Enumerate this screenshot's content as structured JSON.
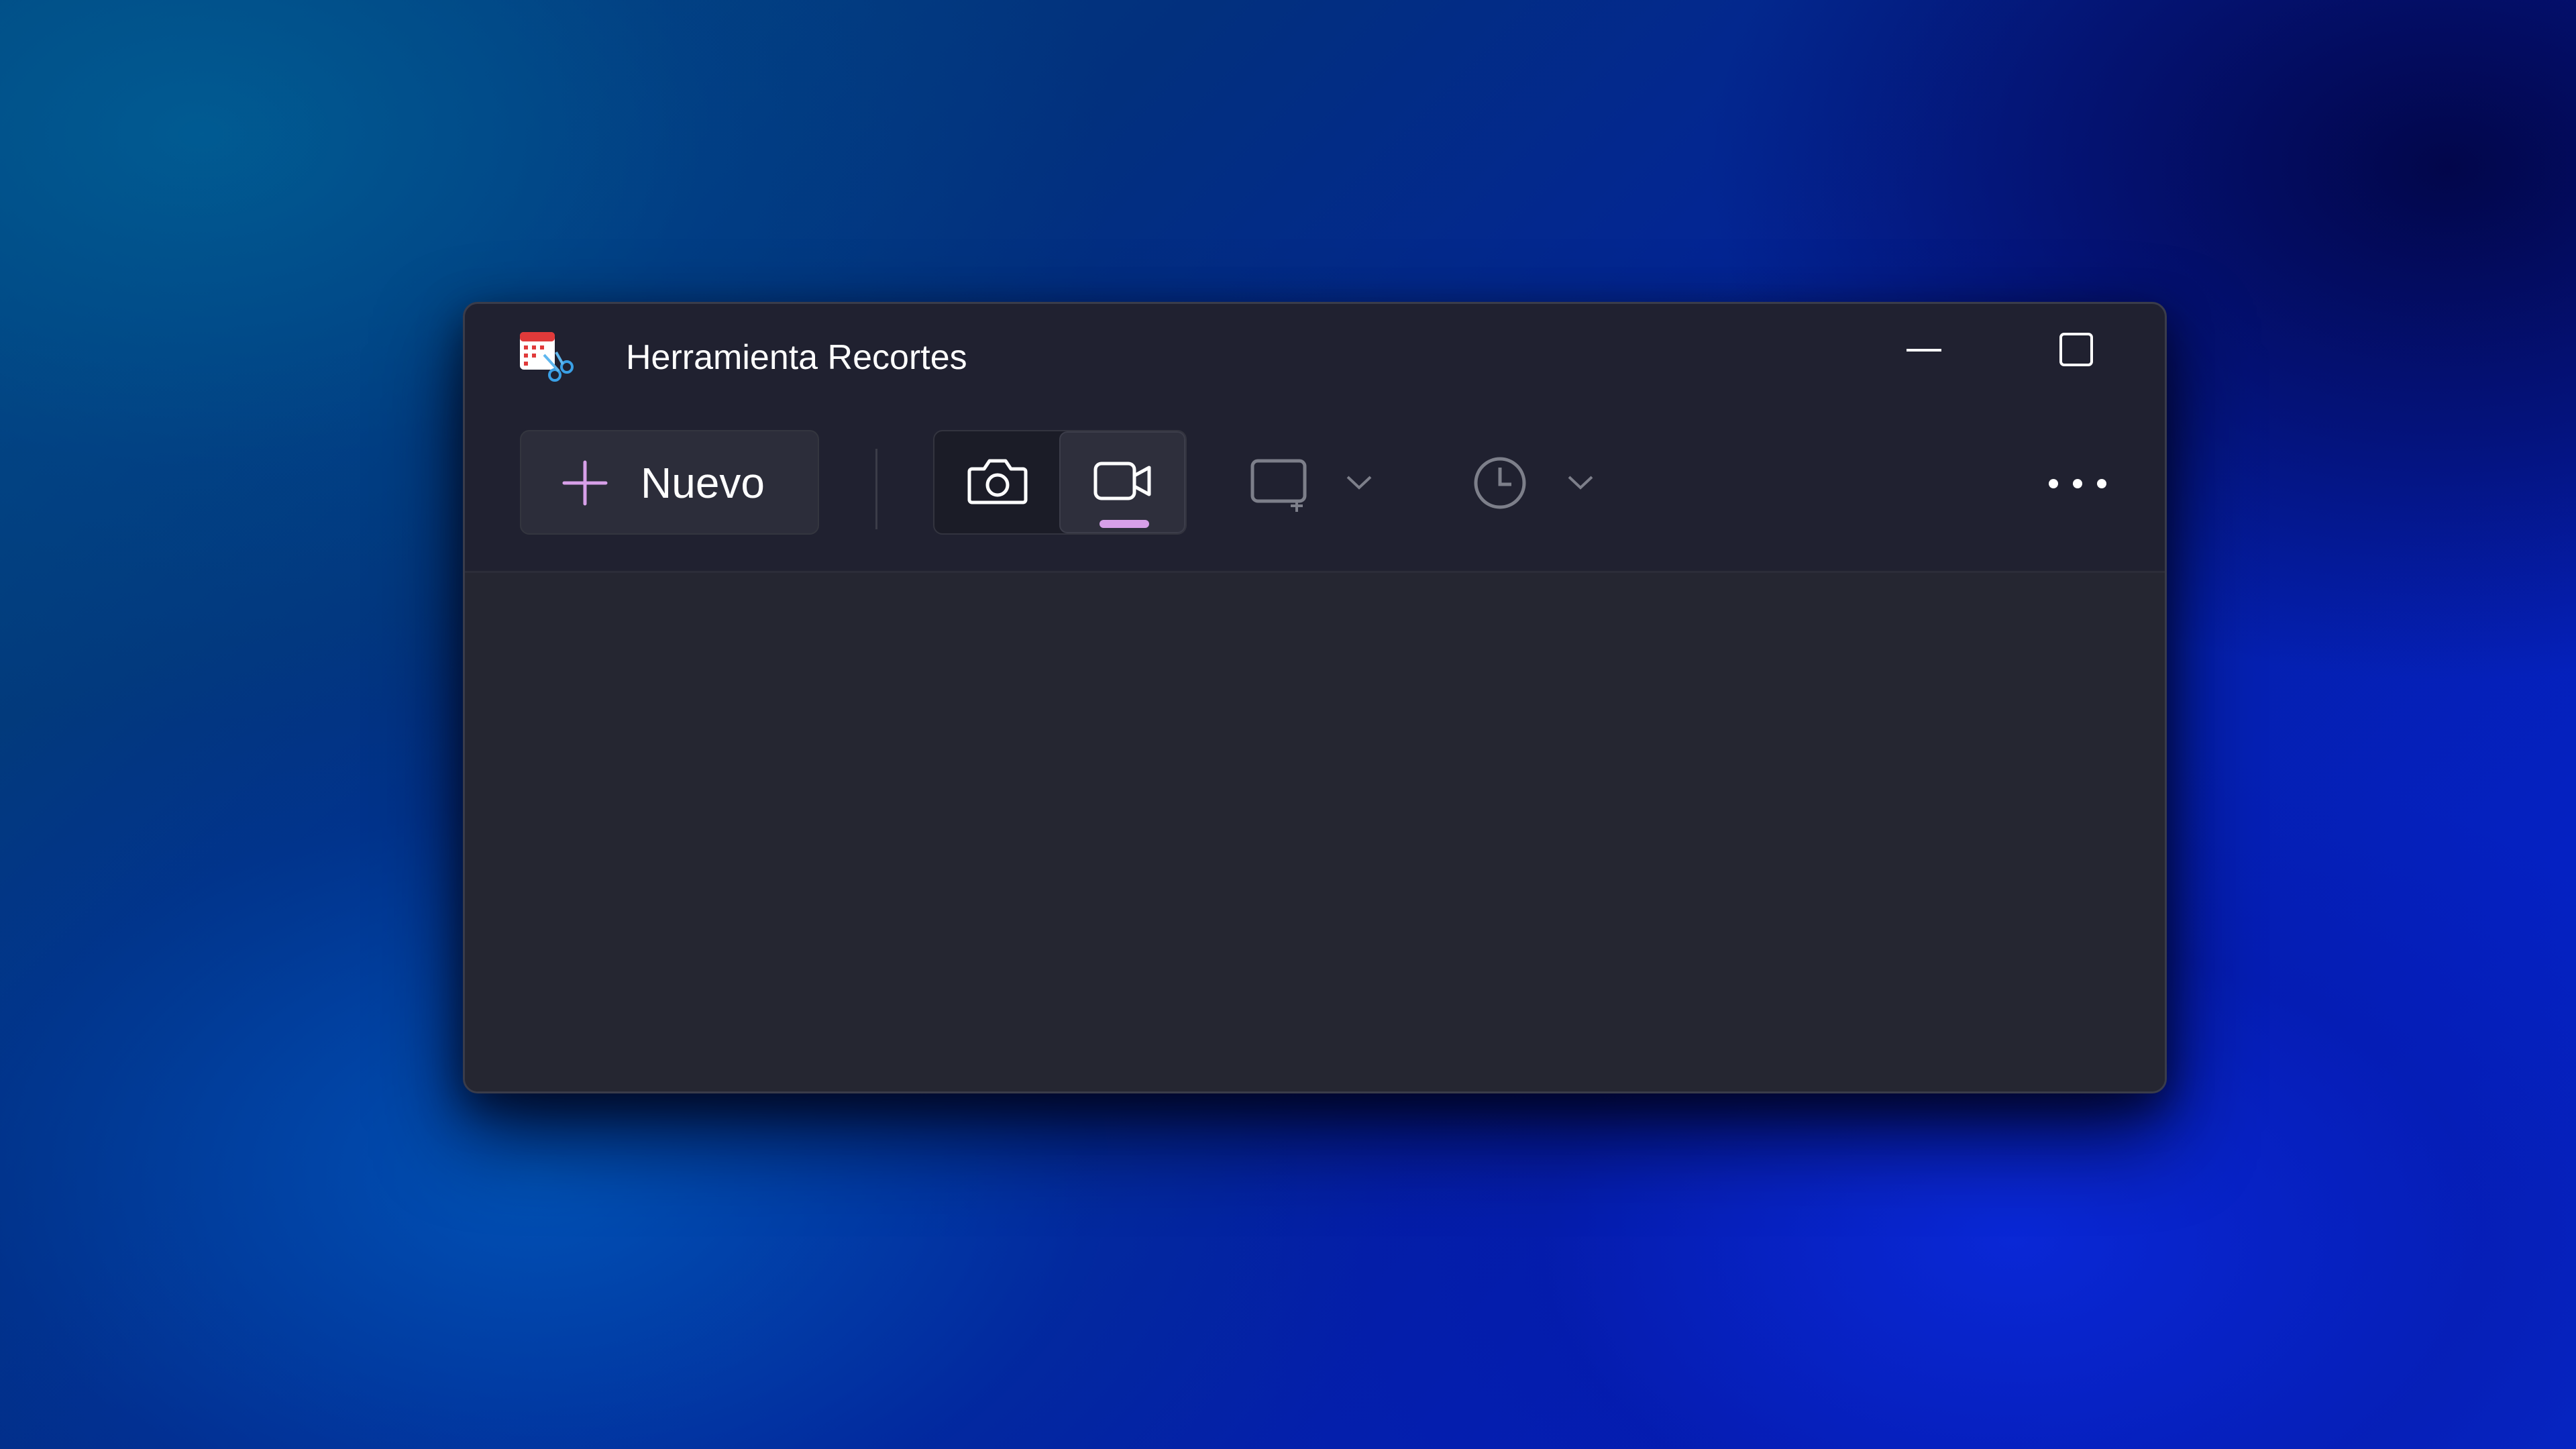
{
  "window": {
    "title": "Herramienta Recortes",
    "app_icon": "snipping-tool-icon"
  },
  "window_controls": {
    "minimize_icon": "minimize-icon",
    "maximize_icon": "maximize-icon",
    "close_icon": "close-icon"
  },
  "toolbar": {
    "new_label": "Nuevo",
    "new_icon": "plus-icon",
    "modes": [
      {
        "icon": "camera-icon",
        "active": false
      },
      {
        "icon": "video-camera-icon",
        "active": true
      }
    ],
    "shape_icon": "rectangle-snip-icon",
    "delay_icon": "clock-icon",
    "dropdown_icon": "chevron-down-icon",
    "more_icon": "more-icon"
  },
  "colors": {
    "accent": "#d7a0e8",
    "window_bg": "#202130",
    "content_bg": "#252631"
  }
}
